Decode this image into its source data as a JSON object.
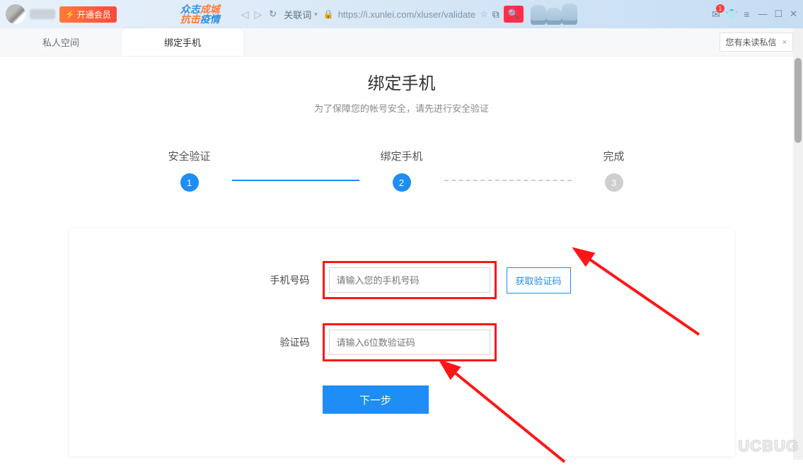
{
  "chrome": {
    "vip_label": "开通会员",
    "slogan_line1_a": "众志",
    "slogan_line1_b": "成城",
    "slogan_line2_a": "抗击",
    "slogan_line2_b": "疫情",
    "addr_label": "关联词",
    "url": "https://i.xunlei.com/xluser/validate",
    "mail_badge": "1",
    "toast_text": "您有未读私信",
    "toast_close": "×"
  },
  "tabs": {
    "tab1": "私人空间",
    "tab2": "绑定手机"
  },
  "page": {
    "title": "绑定手机",
    "subtitle": "为了保障您的帐号安全，请先进行安全验证"
  },
  "steps": {
    "s1_label": "安全验证",
    "s1_num": "1",
    "s2_label": "绑定手机",
    "s2_num": "2",
    "s3_label": "完成",
    "s3_num": "3"
  },
  "form": {
    "phone_label": "手机号码",
    "phone_placeholder": "请输入您的手机号码",
    "code_label": "验证码",
    "code_placeholder": "请输入6位数验证码",
    "get_code_btn": "获取验证码",
    "next_btn": "下一步"
  },
  "watermark": "UCBUG"
}
